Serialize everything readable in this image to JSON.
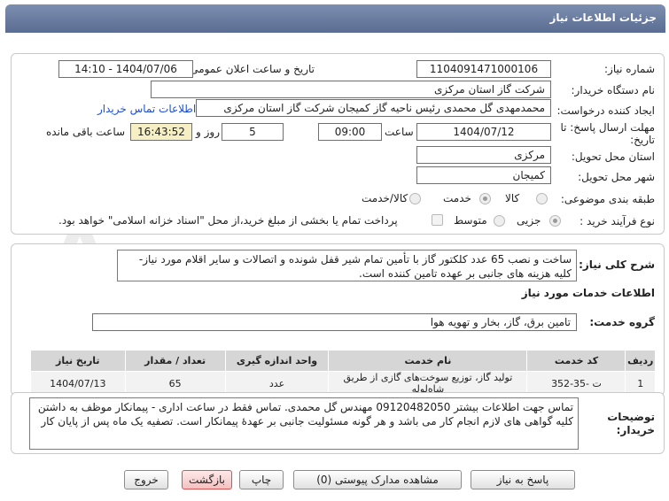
{
  "header": {
    "title": "جزئیات اطلاعات نیاز"
  },
  "watermark": {
    "text": "AriaTender.net"
  },
  "form": {
    "need_number": {
      "label": "شماره نیاز:",
      "value": "1104091471000106"
    },
    "announce_date": {
      "label": "تاریخ و ساعت اعلان عمومی:",
      "value": "1404/07/06 - 14:10"
    },
    "buyer_org": {
      "label": "نام دستگاه خریدار:",
      "value": "شرکت گاز استان مرکزی"
    },
    "requester": {
      "label": "ایجاد کننده درخواست:",
      "value": "محمدمهدی گل محمدی رئیس ناحیه گاز کمیجان شرکت گاز استان مرکزی",
      "link": "اطلاعات تماس خریدار"
    },
    "deadline": {
      "label_line1": "مهلت ارسال پاسخ: تا",
      "label_line2": "تاریخ:",
      "date": "1404/07/12",
      "time_label": "ساعت",
      "time": "09:00",
      "days": "5",
      "days_label": "روز و",
      "remaining": "16:43:52",
      "remaining_label": "ساعت باقی مانده"
    },
    "province": {
      "label": "استان محل تحویل:",
      "value": "مرکزی"
    },
    "city": {
      "label": "شهر محل تحویل:",
      "value": "کمیجان"
    },
    "category": {
      "label": "طبقه بندی موضوعی:",
      "options": [
        "کالا",
        "خدمت",
        "کالا/خدمت"
      ],
      "selected": "خدمت"
    },
    "purchase_type": {
      "label": "نوع فرآیند خرید :",
      "options": [
        "جزیی",
        "متوسط"
      ],
      "selected": "جزیی",
      "payment_note": "پرداخت تمام یا بخشی از مبلغ خرید،از محل \"اسناد خزانه اسلامی\" خواهد بود."
    }
  },
  "summary": {
    "label": "شرح کلی نیاز:",
    "text": "ساخت و نصب 65 عدد کلکتور گاز با تأمین تمام شیر قفل شونده و اتصالات و سایر اقلام مورد نیاز- کلیه هزینه های جانبی بر عهده تامین کننده است."
  },
  "services": {
    "section_title": "اطلاعات خدمات مورد نیاز",
    "group_label": "گروه خدمت:",
    "group_value": "تامین برق، گاز، بخار و تهویه هوا",
    "columns": [
      "ردیف",
      "کد خدمت",
      "نام خدمت",
      "واحد اندازه گیری",
      "تعداد / مقدار",
      "تاریخ نیاز"
    ],
    "rows": [
      {
        "row": "1",
        "code": "ت -35-352",
        "name": "تولید گاز، توزیع سوخت‌های گازی از طریق شاه‌لوله",
        "unit": "عدد",
        "qty": "65",
        "date": "1404/07/13"
      }
    ]
  },
  "buyer_notes": {
    "label_line1": "توضیحات",
    "label_line2": "خریدار:",
    "text": "تماس جهت اطلاعات بیشتر 09120482050 مهندس گل محمدی. تماس فقط در ساعت اداری - پیمانکار موظف به داشتن کلیه گواهی های لازم انجام کار می باشد و هر گونه مسئولیت جانبی بر عهدهٔ پیمانکار است. تصفیه یک ماه پس از پایان کار"
  },
  "buttons": {
    "reply": "پاسخ به نیاز",
    "attachments": "مشاهده مدارک پیوستی (0)",
    "print": "چاپ",
    "back": "بازگشت",
    "exit": "خروج"
  }
}
